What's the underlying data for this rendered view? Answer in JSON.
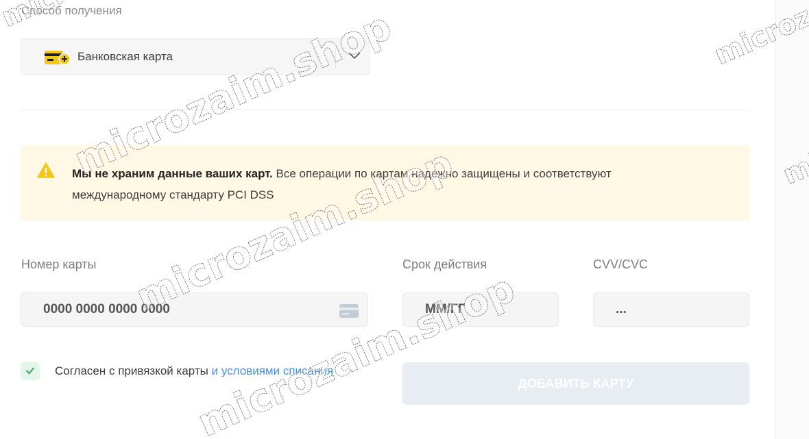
{
  "receive_method": {
    "label": "Способ получения",
    "selected": "Банковская карта",
    "icon": "bank-card-add-icon"
  },
  "notice": {
    "bold": "Мы не храним данные ваших карт.",
    "text": " Все операции по картам надежно защищены и соответствуют международному стандарту PCI DSS",
    "icon": "warning-icon"
  },
  "card_form": {
    "number_label": "Номер карты",
    "number_placeholder": "0000 0000 0000 0000",
    "expiry_label": "Срок действия",
    "expiry_placeholder": "ММ/ГГ",
    "cvv_label": "CVV/CVC",
    "cvv_placeholder": "...",
    "agree_text": "Согласен с привязкой карты ",
    "agree_link": "и условиями списания",
    "agree_checked": true,
    "submit_label": "ДОБАВИТЬ КАРТУ"
  },
  "watermark": "microzaim.shop",
  "colors": {
    "accent_yellow": "#f5c518",
    "notice_bg": "#fff8e4",
    "link_blue": "#4d8fd6",
    "check_green": "#3cae5c",
    "button_disabled": "#e7edf3"
  }
}
